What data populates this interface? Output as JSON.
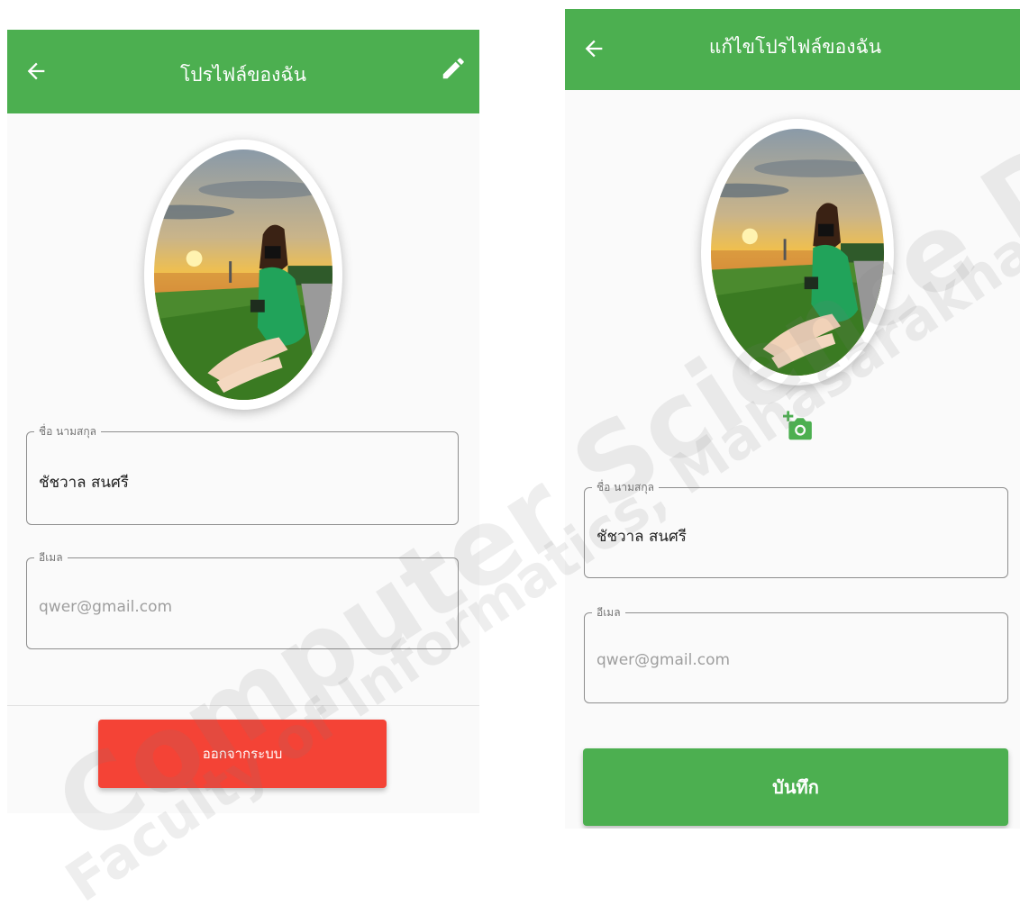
{
  "left_screen": {
    "title": "โปรไฟล์ของฉัน",
    "back_icon": "arrow-left-icon",
    "edit_icon": "pencil-icon",
    "name_field": {
      "label": "ชื่อ นามสกุล",
      "value": "ชัชวาล สนศรี"
    },
    "email_field": {
      "label": "อีเมล",
      "value": "qwer@gmail.com"
    },
    "logout_label": "ออกจากระบบ"
  },
  "right_screen": {
    "title": "แก้ไขโปรไฟล์ของฉัน",
    "back_icon": "arrow-left-icon",
    "camera_icon": "add-photo-icon",
    "name_field": {
      "label": "ชื่อ นามสกุล",
      "value": "ชัชวาล สนศรี"
    },
    "email_field": {
      "label": "อีเมล",
      "value": "qwer@gmail.com"
    },
    "save_label": "บันทึก"
  },
  "watermark": {
    "line1": "Computer Science Department",
    "line2": "Faculty of Informatics, Mahasarakham"
  },
  "colors": {
    "appbar": "#4caf50",
    "logout": "#f44336",
    "save": "#4caf50"
  }
}
